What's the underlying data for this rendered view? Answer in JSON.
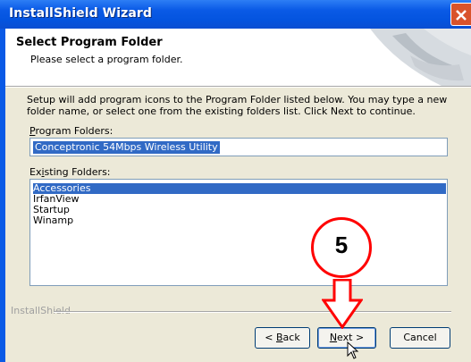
{
  "window": {
    "title": "InstallShield Wizard"
  },
  "header": {
    "title": "Select Program Folder",
    "subtitle": "Please select a program folder."
  },
  "main": {
    "description": "Setup will add program icons to the Program Folder listed below.  You may type a new folder name, or select one from the existing folders list.  Click Next to continue.",
    "program_folders_label_first": "P",
    "program_folders_label_rest": "rogram Folders:",
    "program_folder_value": "Conceptronic 54Mbps Wireless Utility",
    "existing_folders_label_first": "Ex",
    "existing_folders_label_u": "i",
    "existing_folders_label_rest": "sting Folders:",
    "existing_folders": [
      "Accessories",
      "IrfanView",
      "Startup",
      "Winamp"
    ],
    "selected_folder": "Accessories"
  },
  "footer": {
    "brand": "InstallShield",
    "back_u": "B",
    "back_rest": "ack",
    "back_prefix": "< ",
    "next_u": "N",
    "next_rest": "ext >",
    "cancel": "Cancel"
  },
  "annotation": {
    "step_number": "5",
    "color": "#ff0000"
  }
}
